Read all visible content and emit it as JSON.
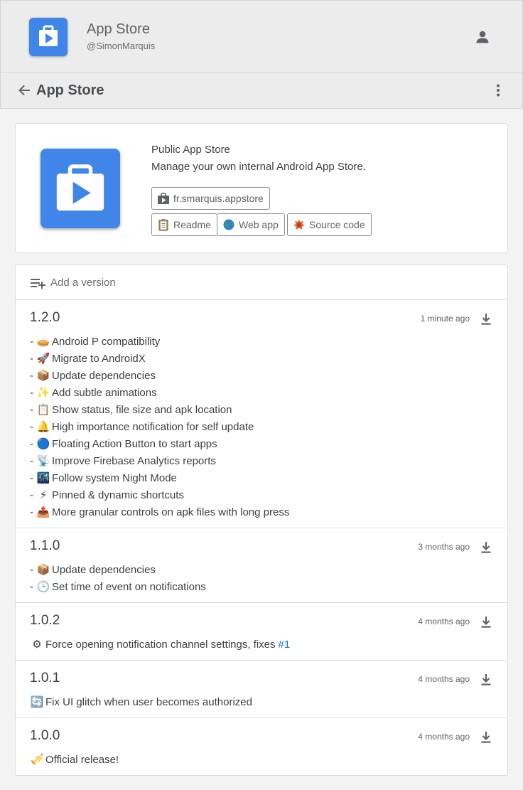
{
  "header": {
    "title": "App Store",
    "username": "@SimonMarquis"
  },
  "toolbar": {
    "title": "App Store"
  },
  "app": {
    "name": "Public App Store",
    "description": "Manage your own internal Android App Store.",
    "package": "fr.smarquis.appstore",
    "links": {
      "readme": "Readme",
      "web": "Web app",
      "source": "Source code"
    }
  },
  "add_version_label": "Add a version",
  "versions": [
    {
      "number": "1.2.0",
      "time": "1 minute ago",
      "notes": [
        {
          "prefix": "-",
          "emoji": "🥧",
          "text": "Android P compatibility"
        },
        {
          "prefix": "-",
          "emoji": "🚀",
          "text": "Migrate to AndroidX"
        },
        {
          "prefix": "-",
          "emoji": "📦",
          "text": "Update dependencies"
        },
        {
          "prefix": "-",
          "emoji": "✨",
          "text": "Add subtle animations"
        },
        {
          "prefix": "-",
          "emoji": "📋",
          "text": "Show status, file size and apk location"
        },
        {
          "prefix": "-",
          "emoji": "🔔",
          "text": "High importance notification for self update"
        },
        {
          "prefix": "-",
          "emoji": "🔵",
          "text": "Floating Action Button to start apps"
        },
        {
          "prefix": "-",
          "emoji": "📡",
          "text": "Improve Firebase Analytics reports"
        },
        {
          "prefix": "-",
          "emoji": "🌃",
          "text": "Follow system Night Mode"
        },
        {
          "prefix": "-",
          "emoji": "⚡",
          "text": "Pinned & dynamic shortcuts"
        },
        {
          "prefix": "-",
          "emoji": "📤",
          "text": "More granular controls on apk files with long press"
        }
      ]
    },
    {
      "number": "1.1.0",
      "time": "3 months ago",
      "notes": [
        {
          "prefix": "-",
          "emoji": "📦",
          "text": "Update dependencies"
        },
        {
          "prefix": "-",
          "emoji": "🕒",
          "text": "Set time of event on notifications"
        }
      ]
    },
    {
      "number": "1.0.2",
      "time": "4 months ago",
      "notes": [
        {
          "prefix": "",
          "emoji": "⚙",
          "text": "Force opening notification channel settings, fixes",
          "link": "#1"
        }
      ]
    },
    {
      "number": "1.0.1",
      "time": "4 months ago",
      "notes": [
        {
          "prefix": "",
          "emoji": "🔄",
          "text": "Fix UI glitch when user becomes authorized"
        }
      ]
    },
    {
      "number": "1.0.0",
      "time": "4 months ago",
      "notes": [
        {
          "prefix": "",
          "emoji": "🎺",
          "text": "Official release!"
        }
      ]
    }
  ]
}
